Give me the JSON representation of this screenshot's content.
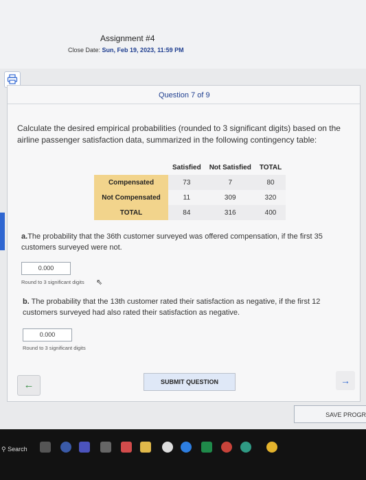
{
  "assignment": {
    "title": "Assignment #4",
    "close_label": "Close Date:",
    "close_value": "Sun, Feb 19, 2023, 11:59 PM"
  },
  "question": {
    "counter": "Question 7 of 9",
    "prompt": "Calculate the desired empirical probabilities (rounded to 3 significant digits) based on the airline passenger satisfaction data, summarized in the following contingency table:"
  },
  "table": {
    "headers": [
      "Satisfied",
      "Not Satisfied",
      "TOTAL"
    ],
    "rows": [
      {
        "label": "Compensated",
        "values": [
          "73",
          "7",
          "80"
        ]
      },
      {
        "label": "Not Compensated",
        "values": [
          "11",
          "309",
          "320"
        ]
      },
      {
        "label": "TOTAL",
        "values": [
          "84",
          "316",
          "400"
        ]
      }
    ]
  },
  "part_a": {
    "letter": "a.",
    "text": "The probability that the 36th customer surveyed was offered compensation, if the first 35 customers surveyed were not.",
    "answer": "0.000",
    "note": "Round to 3 significant digits"
  },
  "part_b": {
    "letter": "b.",
    "text": " The probability that the 13th customer rated their satisfaction as negative, if the first 12 customers surveyed had also rated their satisfaction as negative.",
    "answer": "0.000",
    "note": "Round to 3 significant digits"
  },
  "buttons": {
    "back": "←",
    "submit": "SUBMIT QUESTION",
    "next": "→",
    "save": "SAVE PROGR"
  },
  "taskbar": {
    "search": "Search"
  },
  "colors": {
    "accent": "#2f66d1",
    "row_label_bg": "#f2d48c",
    "link": "#1d3d8f"
  }
}
